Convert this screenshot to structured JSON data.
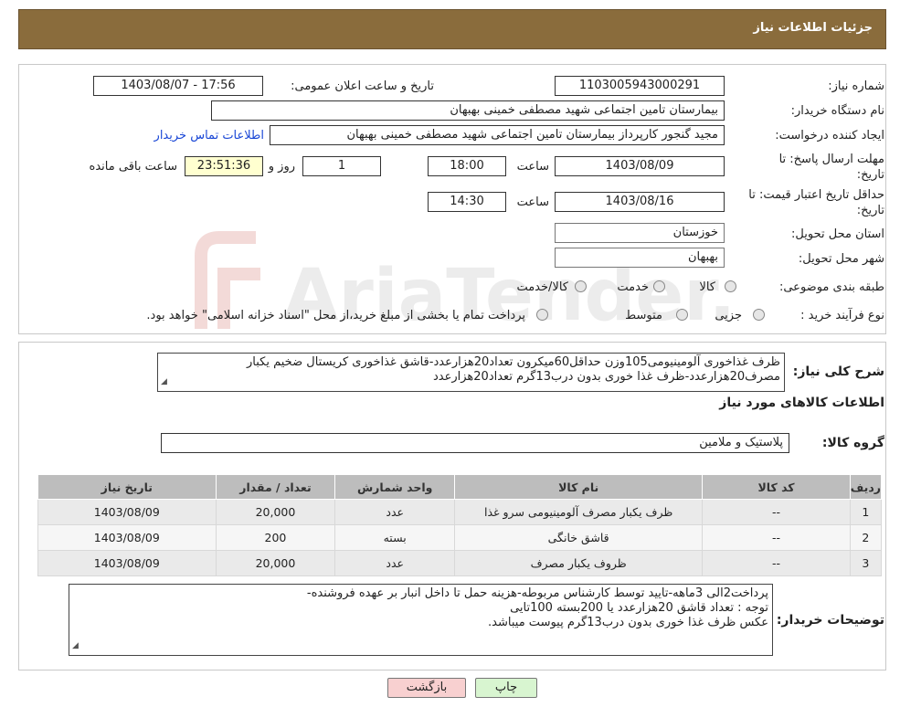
{
  "header": {
    "title": "جزئیات اطلاعات نیاز"
  },
  "info": {
    "need_number_label": "شماره نیاز:",
    "need_number": "1103005943000291",
    "announce_label": "تاریخ و ساعت اعلان عمومی:",
    "announce_value": "1403/08/07 - 17:56",
    "buyer_org_label": "نام دستگاه خریدار:",
    "buyer_org": "بیمارستان تامین اجتماعی شهید مصطفی خمینی بهبهان",
    "creator_label": "ایجاد کننده درخواست:",
    "creator": "مجید گنجور کارپرداز بیمارستان تامین اجتماعی شهید مصطفی خمینی بهبهان",
    "contact_link": "اطلاعات تماس خریدار",
    "deadline_label_1": "مهلت ارسال پاسخ: تا",
    "deadline_label_2": "تاریخ:",
    "deadline_date": "1403/08/09",
    "time_label": "ساعت",
    "deadline_time": "18:00",
    "days_value": "1",
    "days_label": "روز و",
    "remaining_time": "23:51:36",
    "remaining_label": "ساعت باقی مانده",
    "validity_label_1": "حداقل تاریخ اعتبار قیمت: تا",
    "validity_label_2": "تاریخ:",
    "validity_date": "1403/08/16",
    "validity_time": "14:30",
    "province_label": "استان محل تحویل:",
    "province": "خوزستان",
    "city_label": "شهر محل تحویل:",
    "city": "بهبهان",
    "category_label": "طبقه بندی موضوعی:",
    "category_options": [
      "کالا",
      "خدمت",
      "کالا/خدمت"
    ],
    "process_label": "نوع فرآیند خرید :",
    "process_options": [
      "جزیی",
      "متوسط"
    ],
    "process_note": "پرداخت تمام یا بخشی از مبلغ خرید،از محل \"اسناد خزانه اسلامی\" خواهد بود."
  },
  "details": {
    "summary_label": "شرح کلی نیاز:",
    "summary_line1": "ظرف غذاخوری آلومینیومی105وزن حداقل60میکرون تعداد20هزارعدد-قاشق غذاخوری کریستال ضخیم یکبار",
    "summary_line2": "مصرف20هزارعدد-ظرف غذا خوری بدون درب13گرم تعداد20هزارعدد",
    "goods_info_title": "اطلاعات کالاهای مورد نیاز",
    "group_label": "گروه کالا:",
    "group_value": "پلاستیک و ملامین",
    "table": {
      "headers": [
        "ردیف",
        "کد کالا",
        "نام کالا",
        "واحد شمارش",
        "تعداد / مقدار",
        "تاریخ نیاز"
      ],
      "rows": [
        [
          "1",
          "--",
          "ظرف یکبار مصرف آلومینیومی سرو غذا",
          "عدد",
          "20,000",
          "1403/08/09"
        ],
        [
          "2",
          "--",
          "قاشق خانگی",
          "بسته",
          "200",
          "1403/08/09"
        ],
        [
          "3",
          "--",
          "ظروف یکبار مصرف",
          "عدد",
          "20,000",
          "1403/08/09"
        ]
      ]
    },
    "buyer_notes_label": "توضیحات خریدار:",
    "buyer_notes_line1": "پرداخت2الی 3ماهه-تایید توسط کارشناس مربوطه-هزینه حمل تا داخل انبار بر عهده فروشنده-",
    "buyer_notes_line2": "توجه : تعداد قاشق 20هزارعدد یا 200بسته 100تایی",
    "buyer_notes_line3": "عکس ظرف غذا خوری بدون درب13گرم پیوست میباشد."
  },
  "buttons": {
    "print": "چاپ",
    "back": "بازگشت"
  },
  "watermark": {
    "text": "AriaTender.neT"
  },
  "colors": {
    "header_bg": "#8a6c3c",
    "link": "#1a47d6",
    "time_highlight": "#ffffd0",
    "back_button": "#f8d0d0",
    "print_button": "#d8f5d0"
  }
}
